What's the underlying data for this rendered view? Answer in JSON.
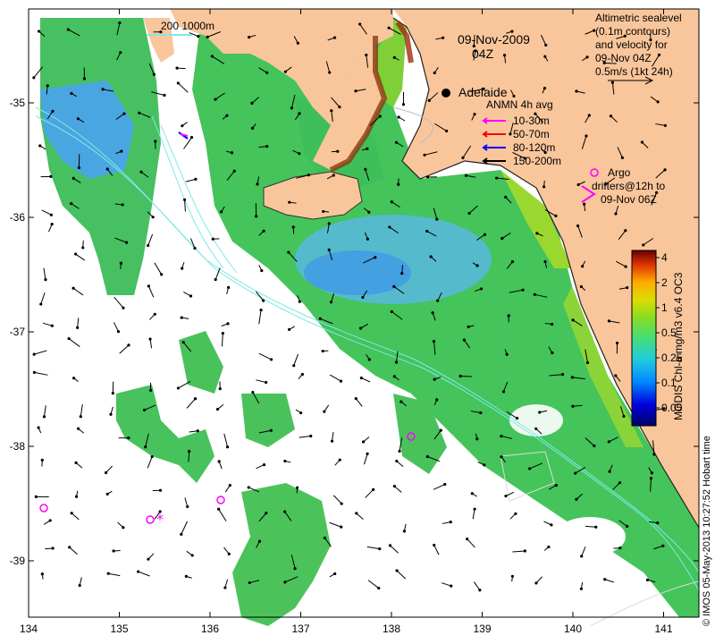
{
  "title": {
    "date": "09-Nov-2009",
    "time": "04Z"
  },
  "scale_label": "200  1000m",
  "city": {
    "name": "Adelaide"
  },
  "sealevel_note": {
    "lines": [
      "Altimetric sealevel",
      "(0.1m contours)",
      "and velocity for",
      "09-Nov 04Z",
      "0.5m/s (1kt 24h)"
    ]
  },
  "anmn": {
    "title": "ANMN 4h avg",
    "items": [
      {
        "label": "10-30m",
        "color": "#ff00ff"
      },
      {
        "label": "50-70m",
        "color": "#ff0000"
      },
      {
        "label": "80-120m",
        "color": "#0000ff"
      },
      {
        "label": "150-200m",
        "color": "#000000"
      }
    ]
  },
  "argo": {
    "lines": [
      "Argo",
      "drifters@12h to",
      "09-Nov 06Z"
    ],
    "color": "#ff00ff"
  },
  "colorbar": {
    "label": "MODIS Chl-a mg/m3 v6.4 OC3",
    "ticks": [
      "4",
      "2",
      "1",
      "0.5",
      "0.25",
      "0.1",
      "0.05"
    ],
    "colors": [
      "#000066",
      "#0000cc",
      "#0066ff",
      "#00bbee",
      "#33dd99",
      "#66dd33",
      "#aadd00",
      "#ffdd00",
      "#ff8800",
      "#dd2200",
      "#660000"
    ]
  },
  "x_ticks": [
    "134",
    "135",
    "136",
    "137",
    "138",
    "139",
    "140",
    "141"
  ],
  "y_ticks": [
    "-35",
    "-36",
    "-37",
    "-38",
    "-39"
  ],
  "credit": "© IMOS 05-May-2013 10:27:52 Hobart time",
  "colors": {
    "land": "#f9c69b",
    "coast_brown": "#8b3a10",
    "ocean_high": "#44cc55",
    "ocean_low": "#55aaee",
    "contour": "#7fe8e8"
  }
}
